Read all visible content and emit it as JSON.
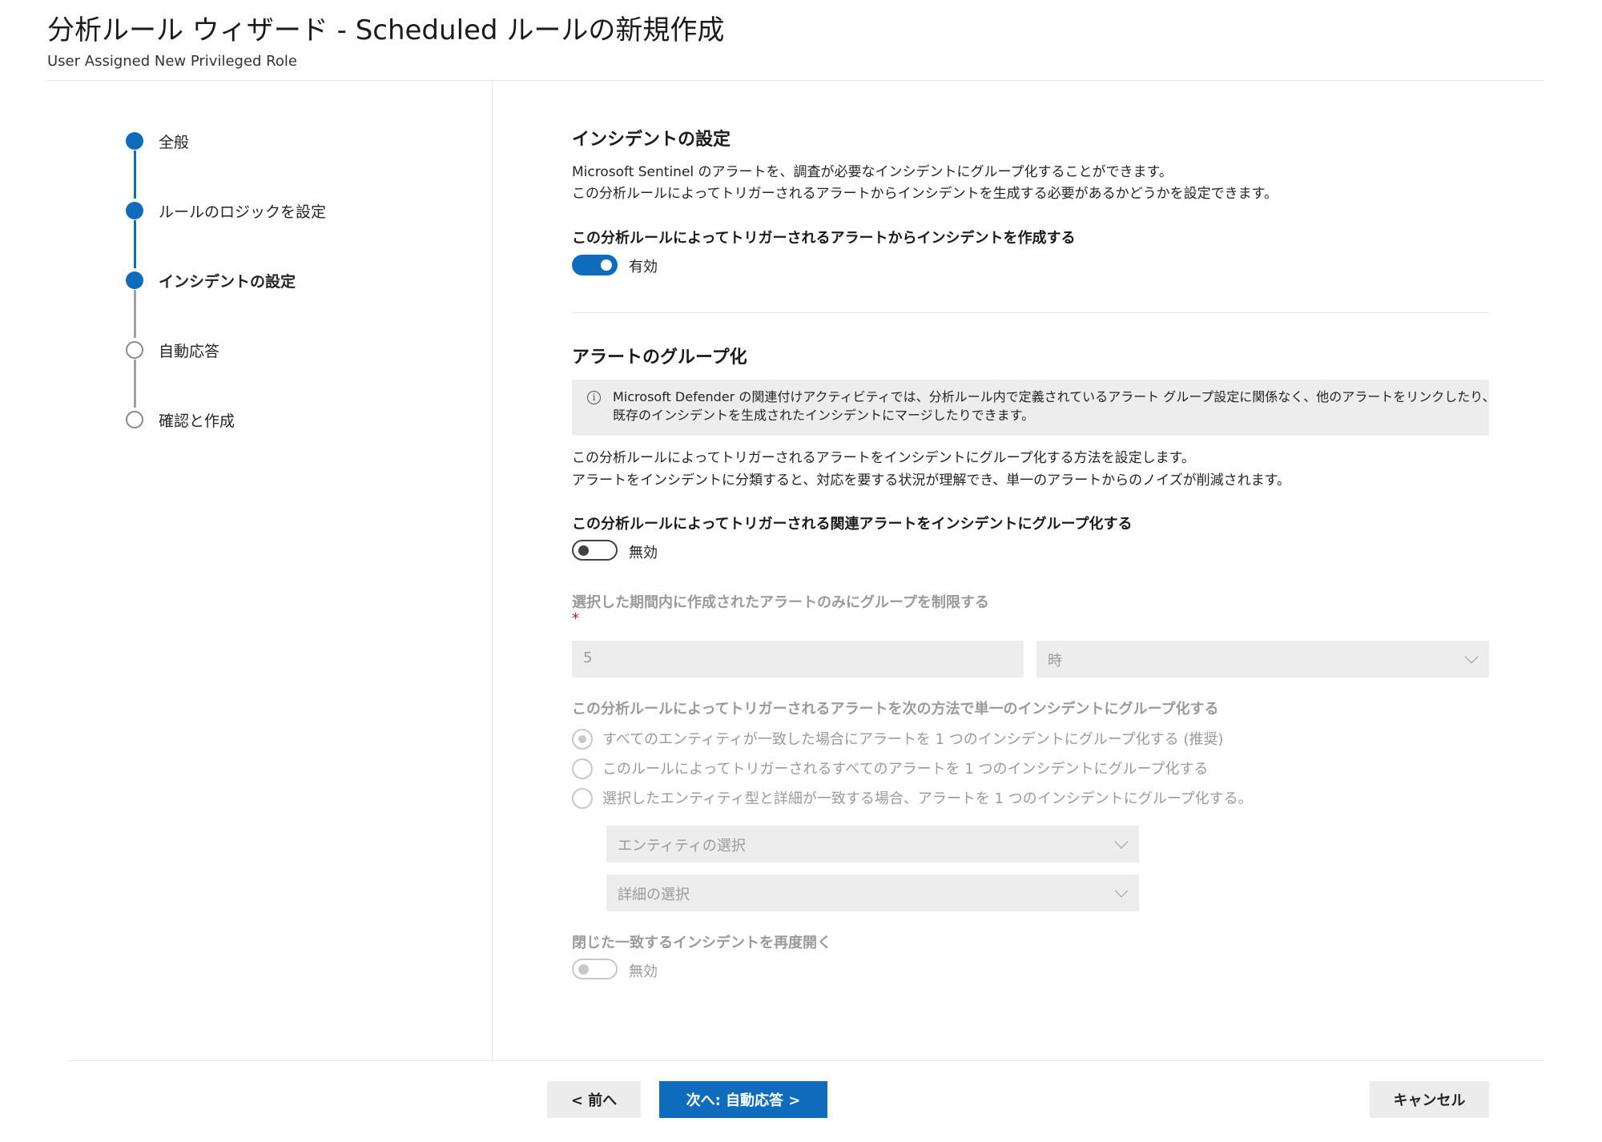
{
  "header": {
    "title": "分析ルール ウィザード - Scheduled ルールの新規作成",
    "subtitle": "User Assigned New Privileged Role"
  },
  "steps": [
    {
      "label": "全般",
      "status": "done"
    },
    {
      "label": "ルールのロジックを設定",
      "status": "done"
    },
    {
      "label": "インシデントの設定",
      "status": "current"
    },
    {
      "label": "自動応答",
      "status": "todo"
    },
    {
      "label": "確認と作成",
      "status": "todo"
    }
  ],
  "incident": {
    "heading": "インシデントの設定",
    "desc_line1": "Microsoft Sentinel のアラートを、調査が必要なインシデントにグループ化することができます。",
    "desc_line2": "この分析ルールによってトリガーされるアラートからインシデントを生成する必要があるかどうかを設定できます。",
    "create_label": "この分析ルールによってトリガーされるアラートからインシデントを作成する",
    "create_toggle_state": "有効"
  },
  "grouping": {
    "heading": "アラートのグループ化",
    "info_line1": "Microsoft Defender の関連付けアクティビティでは、分析ルール内で定義されているアラート グループ設定に関係なく、他のアラートをリンクしたり、",
    "info_line2": "既存のインシデントを生成されたインシデントにマージしたりできます。",
    "desc_line1": "この分析ルールによってトリガーされるアラートをインシデントにグループ化する方法を設定します。",
    "desc_line2": "アラートをインシデントに分類すると、対応を要する状況が理解でき、単一のアラートからのノイズが削減されます。",
    "group_label": "この分析ルールによってトリガーされる関連アラートをインシデントにグループ化する",
    "group_toggle_state": "無効",
    "limit_label": "選択した期間内に作成されたアラートのみにグループを制限する",
    "required_mark": "*",
    "period_value": "5",
    "period_unit": "時",
    "method_label": "この分析ルールによってトリガーされるアラートを次の方法で単一のインシデントにグループ化する",
    "options": [
      {
        "label": "すべてのエンティティが一致した場合にアラートを 1 つのインシデントにグループ化する (推奨)",
        "checked": true
      },
      {
        "label": "このルールによってトリガーされるすべてのアラートを 1 つのインシデントにグループ化する",
        "checked": false
      },
      {
        "label": "選択したエンティティ型と詳細が一致する場合、アラートを 1 つのインシデントにグループ化する。",
        "checked": false
      }
    ],
    "entity_placeholder": "エンティティの選択",
    "detail_placeholder": "詳細の選択",
    "reopen_label": "閉じた一致するインシデントを再度開く",
    "reopen_toggle_state": "無効"
  },
  "footer": {
    "prev_label": "< 前へ",
    "next_label": "次へ: 自動応答 >",
    "cancel_label": "キャンセル"
  }
}
